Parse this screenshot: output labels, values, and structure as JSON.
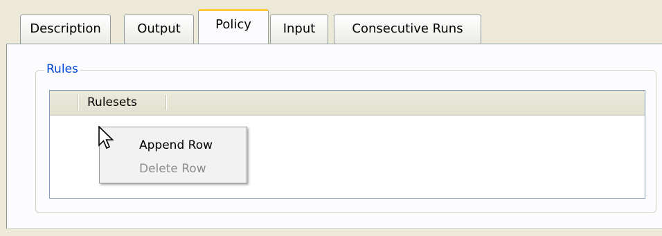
{
  "tabs": [
    {
      "label": "Description"
    },
    {
      "label": "Output"
    },
    {
      "label": "Policy",
      "active": true
    },
    {
      "label": "Input"
    },
    {
      "label": "Consecutive Runs"
    }
  ],
  "group": {
    "title": "Rules"
  },
  "grid": {
    "columns": [
      "Rulesets"
    ],
    "rows": []
  },
  "context_menu": {
    "items": [
      {
        "label": "Append Row",
        "enabled": true
      },
      {
        "label": "Delete Row",
        "enabled": false
      }
    ]
  },
  "colors": {
    "window_bg": "#ece9d8",
    "page_bg": "#fcfcfe",
    "active_tab_accent": "#ffc83c",
    "group_title": "#0046d5",
    "grid_border": "#7f9db9",
    "menu_disabled_text": "#8d8d8d"
  },
  "icons": {
    "cursor": "arrow-cursor-icon"
  }
}
